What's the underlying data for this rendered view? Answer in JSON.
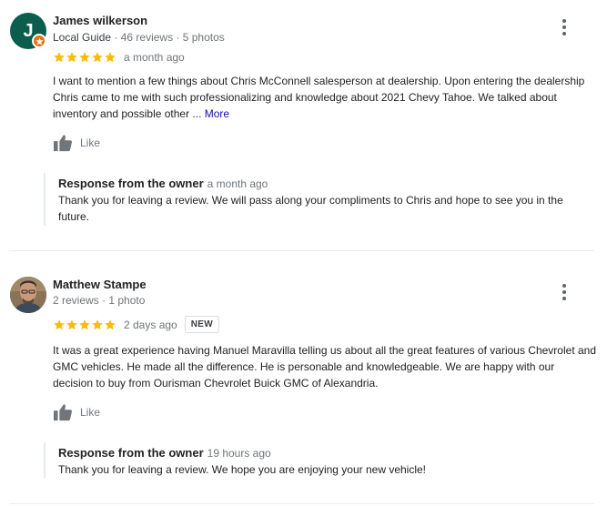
{
  "colors": {
    "star": "#fbbc04",
    "avatar_bg": "#0b5e4d",
    "guide_badge": "#e8710a",
    "link": "#1a0dab"
  },
  "reviews": [
    {
      "avatar_letter": "J",
      "name": "James wilkerson",
      "meta_role": "Local Guide",
      "meta_sep1": " · ",
      "meta_reviews": "46 reviews",
      "meta_sep2": " · ",
      "meta_photos": "5 photos",
      "rating": 5,
      "when": "a month ago",
      "text": "I want to mention a few things about Chris McConnell salesperson at dealership. Upon entering the dealership Chris came to me with such professionalizing and knowledge about 2021 Chevy Tahoe. We talked about inventory and possible other ... ",
      "more_label": "More",
      "like_label": "Like",
      "response": {
        "heading": "Response from the owner",
        "when": "a month ago",
        "text": "Thank you for leaving a review. We will pass along your compliments to Chris and hope to see you in the future."
      }
    },
    {
      "name": "Matthew Stampe",
      "meta_reviews": "2 reviews",
      "meta_sep": " · ",
      "meta_photos": "1 photo",
      "rating": 5,
      "when": "2 days ago",
      "badge": "NEW",
      "text": "It was a great experience having Manuel Maravilla telling us about all the great features of various Chevrolet and GMC vehicles. He made all the difference. He is personable and knowledgeable.  We are happy with our decision to buy from Ourisman Chevrolet Buick GMC of Alexandria.",
      "like_label": "Like",
      "response": {
        "heading": "Response from the owner",
        "when": "19 hours ago",
        "text": "Thank you for leaving a review. We hope you are enjoying your new vehicle!"
      }
    }
  ]
}
